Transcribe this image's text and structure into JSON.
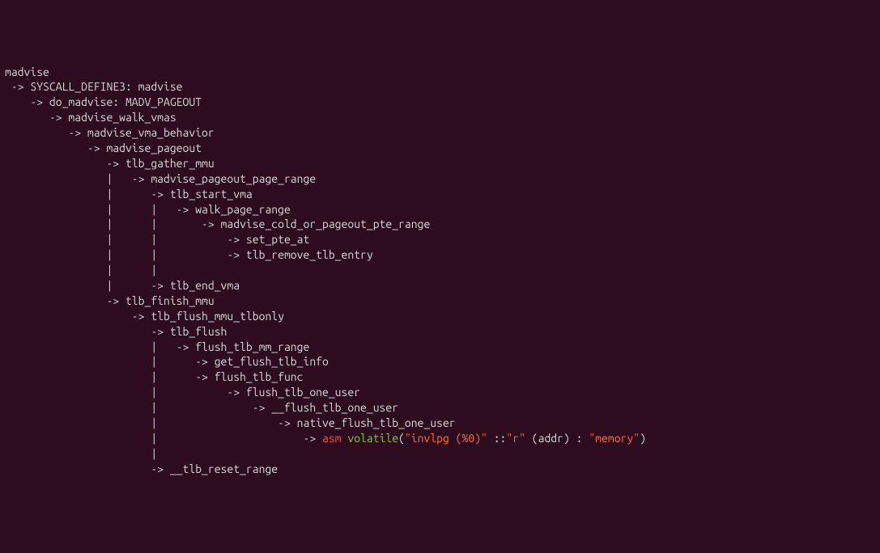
{
  "lines": [
    {
      "text": "madvise"
    },
    {
      "text": " -> SYSCALL_DEFINE3: madvise"
    },
    {
      "text": "    -> do_madvise: MADV_PAGEOUT"
    },
    {
      "text": "       -> madvise_walk_vmas"
    },
    {
      "text": "          -> madvise_vma_behavior"
    },
    {
      "text": "             -> madvise_pageout"
    },
    {
      "text": "                -> tlb_gather_mmu"
    },
    {
      "text": "                |   -> madvise_pageout_page_range"
    },
    {
      "text": "                |      -> tlb_start_vma"
    },
    {
      "text": "                |      |   -> walk_page_range"
    },
    {
      "text": "                |      |       -> madvise_cold_or_pageout_pte_range"
    },
    {
      "text": "                |      |           -> set_pte_at"
    },
    {
      "text": "                |      |           -> tlb_remove_tlb_entry"
    },
    {
      "text": "                |      |"
    },
    {
      "text": "                |      -> tlb_end_vma"
    },
    {
      "text": "                -> tlb_finish_mmu"
    },
    {
      "text": "                    -> tlb_flush_mmu_tlbonly"
    },
    {
      "text": "                       -> tlb_flush"
    },
    {
      "text": "                       |   -> flush_tlb_mm_range"
    },
    {
      "text": "                       |      -> get_flush_tlb_info"
    },
    {
      "text": "                       |      -> flush_tlb_func"
    },
    {
      "text": "                       |           -> flush_tlb_one_user"
    },
    {
      "text": "                       |               -> __flush_tlb_one_user"
    },
    {
      "text": "                       |                   -> native_flush_tlb_one_user"
    },
    {
      "asm": true,
      "prefix": "                       |                       -> ",
      "kw_asm": "asm",
      "kw_volatile": "volatile",
      "paren_open": "(",
      "str1": "\"invlpg (%0)\"",
      "sep1": " ::",
      "str2": "\"r\"",
      "mid": " (addr) : ",
      "str3": "\"memory\"",
      "paren_close": ")"
    },
    {
      "text": "                       |"
    },
    {
      "text": "                       -> __tlb_reset_range"
    }
  ]
}
